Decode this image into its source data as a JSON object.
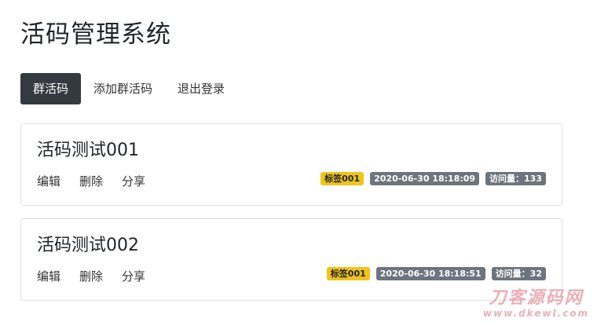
{
  "header": {
    "title": "活码管理系统"
  },
  "nav": {
    "items": [
      {
        "label": "群活码",
        "active": true
      },
      {
        "label": "添加群活码",
        "active": false
      },
      {
        "label": "退出登录",
        "active": false
      }
    ]
  },
  "cards": [
    {
      "title": "活码测试001",
      "actions": {
        "edit": "编辑",
        "delete": "删除",
        "share": "分享"
      },
      "tag": "标签001",
      "timestamp": "2020-06-30 18:18:09",
      "visits": "访问量：133"
    },
    {
      "title": "活码测试002",
      "actions": {
        "edit": "编辑",
        "delete": "删除",
        "share": "分享"
      },
      "tag": "标签001",
      "timestamp": "2020-06-30 18:18:51",
      "visits": "访问量：32"
    }
  ],
  "watermark": {
    "cn": "刀客源码网",
    "en": "www.dkewl.com"
  },
  "colors": {
    "nav_active_bg": "#343a40",
    "tag_badge": "#f0c419",
    "secondary_badge": "#6c757d",
    "card_border": "#dee2e6"
  }
}
